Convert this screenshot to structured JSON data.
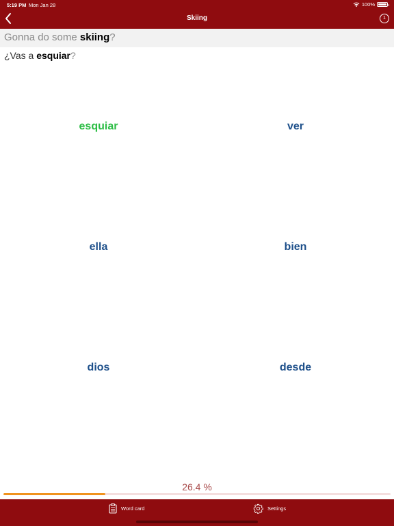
{
  "status_bar": {
    "time": "5:19 PM",
    "date": "Mon Jan 28",
    "battery": "100%"
  },
  "nav": {
    "title": "Skiing",
    "counter": "1"
  },
  "prompt": {
    "before": "Gonna do some ",
    "key": "skiing",
    "after": "?"
  },
  "answer": {
    "before": "¿Vas a ",
    "key": "esquiar",
    "after": "?"
  },
  "choices": [
    {
      "label": "esquiar",
      "state": "correct"
    },
    {
      "label": "ver",
      "state": "default"
    },
    {
      "label": "ella",
      "state": "default"
    },
    {
      "label": "bien",
      "state": "default"
    },
    {
      "label": "dios",
      "state": "default"
    },
    {
      "label": "desde",
      "state": "default"
    }
  ],
  "progress": {
    "label": "26.4 %",
    "value": 26.4
  },
  "tabbar": {
    "word_card": "Word card",
    "settings": "Settings"
  },
  "colors": {
    "brand": "#8f0c0f",
    "correct": "#2bbd44",
    "choice": "#1d4f8a",
    "progress": "#f0931e"
  },
  "icons": {
    "back": "chevron-left-icon",
    "counter": "circle-count-icon",
    "word_card": "clipboard-icon",
    "settings": "gear-icon",
    "wifi": "wifi-icon",
    "battery": "battery-icon"
  }
}
